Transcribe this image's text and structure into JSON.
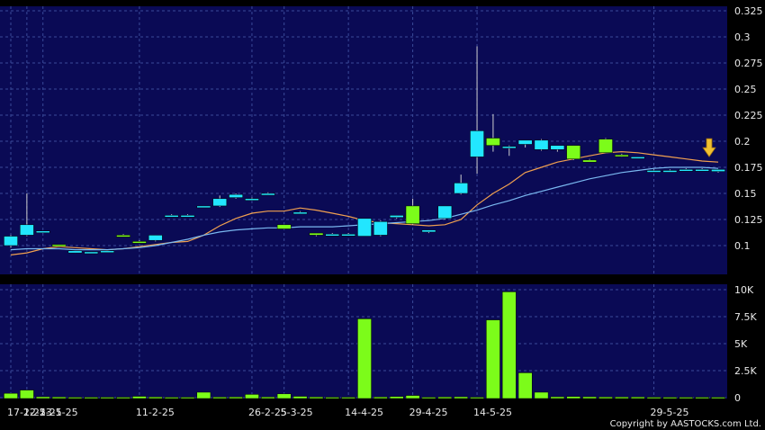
{
  "chart_data": [
    {
      "type": "candlestick",
      "panel": "price",
      "ylim": [
        0.075,
        0.325
      ],
      "yticks": [
        "0.1",
        "0.125",
        "0.15",
        "0.175",
        "0.2",
        "0.225",
        "0.25",
        "0.275",
        "0.3",
        "0.325"
      ],
      "candles": [
        {
          "o": 0.1,
          "h": 0.11,
          "l": 0.098,
          "c": 0.109,
          "color": "cyan"
        },
        {
          "o": 0.11,
          "h": 0.15,
          "l": 0.109,
          "c": 0.12,
          "color": "cyan"
        },
        {
          "o": 0.114,
          "h": 0.114,
          "l": 0.112,
          "c": 0.113,
          "color": "cyan"
        },
        {
          "o": 0.101,
          "h": 0.101,
          "l": 0.099,
          "c": 0.1,
          "color": "green"
        },
        {
          "o": 0.095,
          "h": 0.095,
          "l": 0.093,
          "c": 0.093,
          "color": "cyan"
        },
        {
          "o": 0.094,
          "h": 0.094,
          "l": 0.093,
          "c": 0.093,
          "color": "cyan"
        },
        {
          "o": 0.095,
          "h": 0.095,
          "l": 0.094,
          "c": 0.094,
          "color": "cyan"
        },
        {
          "o": 0.11,
          "h": 0.111,
          "l": 0.109,
          "c": 0.109,
          "color": "green"
        },
        {
          "o": 0.104,
          "h": 0.105,
          "l": 0.103,
          "c": 0.104,
          "color": "green"
        },
        {
          "o": 0.105,
          "h": 0.11,
          "l": 0.104,
          "c": 0.11,
          "color": "cyan"
        },
        {
          "o": 0.129,
          "h": 0.13,
          "l": 0.128,
          "c": 0.129,
          "color": "cyan"
        },
        {
          "o": 0.129,
          "h": 0.13,
          "l": 0.128,
          "c": 0.128,
          "color": "cyan"
        },
        {
          "o": 0.138,
          "h": 0.138,
          "l": 0.137,
          "c": 0.137,
          "color": "cyan"
        },
        {
          "o": 0.138,
          "h": 0.148,
          "l": 0.137,
          "c": 0.145,
          "color": "cyan"
        },
        {
          "o": 0.146,
          "h": 0.15,
          "l": 0.145,
          "c": 0.149,
          "color": "cyan"
        },
        {
          "o": 0.145,
          "h": 0.146,
          "l": 0.144,
          "c": 0.145,
          "color": "cyan"
        },
        {
          "o": 0.15,
          "h": 0.151,
          "l": 0.149,
          "c": 0.15,
          "color": "cyan"
        },
        {
          "o": 0.12,
          "h": 0.12,
          "l": 0.116,
          "c": 0.116,
          "color": "green"
        },
        {
          "o": 0.132,
          "h": 0.133,
          "l": 0.131,
          "c": 0.132,
          "color": "cyan"
        },
        {
          "o": 0.112,
          "h": 0.112,
          "l": 0.109,
          "c": 0.11,
          "color": "green"
        },
        {
          "o": 0.111,
          "h": 0.112,
          "l": 0.11,
          "c": 0.111,
          "color": "cyan"
        },
        {
          "o": 0.111,
          "h": 0.112,
          "l": 0.11,
          "c": 0.111,
          "color": "cyan"
        },
        {
          "o": 0.109,
          "h": 0.125,
          "l": 0.109,
          "c": 0.126,
          "color": "cyan"
        },
        {
          "o": 0.11,
          "h": 0.124,
          "l": 0.109,
          "c": 0.123,
          "color": "cyan"
        },
        {
          "o": 0.127,
          "h": 0.129,
          "l": 0.126,
          "c": 0.129,
          "color": "cyan"
        },
        {
          "o": 0.138,
          "h": 0.145,
          "l": 0.12,
          "c": 0.121,
          "color": "green"
        },
        {
          "o": 0.115,
          "h": 0.115,
          "l": 0.112,
          "c": 0.113,
          "color": "cyan"
        },
        {
          "o": 0.126,
          "h": 0.138,
          "l": 0.125,
          "c": 0.138,
          "color": "cyan"
        },
        {
          "o": 0.15,
          "h": 0.168,
          "l": 0.149,
          "c": 0.16,
          "color": "cyan"
        },
        {
          "o": 0.185,
          "h": 0.291,
          "l": 0.169,
          "c": 0.21,
          "color": "cyan"
        },
        {
          "o": 0.203,
          "h": 0.226,
          "l": 0.19,
          "c": 0.196,
          "color": "green"
        },
        {
          "o": 0.195,
          "h": 0.196,
          "l": 0.186,
          "c": 0.195,
          "color": "cyan"
        },
        {
          "o": 0.197,
          "h": 0.198,
          "l": 0.194,
          "c": 0.201,
          "color": "cyan"
        },
        {
          "o": 0.192,
          "h": 0.202,
          "l": 0.191,
          "c": 0.201,
          "color": "cyan"
        },
        {
          "o": 0.192,
          "h": 0.193,
          "l": 0.19,
          "c": 0.196,
          "color": "cyan"
        },
        {
          "o": 0.196,
          "h": 0.196,
          "l": 0.182,
          "c": 0.183,
          "color": "green"
        },
        {
          "o": 0.182,
          "h": 0.183,
          "l": 0.18,
          "c": 0.18,
          "color": "green"
        },
        {
          "o": 0.202,
          "h": 0.203,
          "l": 0.189,
          "c": 0.189,
          "color": "green"
        },
        {
          "o": 0.187,
          "h": 0.188,
          "l": 0.185,
          "c": 0.186,
          "color": "green"
        },
        {
          "o": 0.185,
          "h": 0.185,
          "l": 0.184,
          "c": 0.184,
          "color": "cyan"
        },
        {
          "o": 0.172,
          "h": 0.173,
          "l": 0.171,
          "c": 0.172,
          "color": "cyan"
        },
        {
          "o": 0.172,
          "h": 0.173,
          "l": 0.171,
          "c": 0.172,
          "color": "cyan"
        },
        {
          "o": 0.173,
          "h": 0.174,
          "l": 0.172,
          "c": 0.173,
          "color": "cyan"
        },
        {
          "o": 0.173,
          "h": 0.174,
          "l": 0.172,
          "c": 0.173,
          "color": "cyan"
        },
        {
          "o": 0.173,
          "h": 0.173,
          "l": 0.17,
          "c": 0.171,
          "color": "cyan"
        }
      ],
      "series": [
        {
          "color": "#f0a050",
          "values": [
            0.091,
            0.093,
            0.097,
            0.099,
            0.098,
            0.097,
            0.096,
            0.097,
            0.099,
            0.101,
            0.103,
            0.104,
            0.11,
            0.119,
            0.126,
            0.131,
            0.133,
            0.133,
            0.136,
            0.134,
            0.131,
            0.128,
            0.124,
            0.122,
            0.121,
            0.12,
            0.119,
            0.12,
            0.125,
            0.139,
            0.15,
            0.159,
            0.17,
            0.175,
            0.18,
            0.183,
            0.186,
            0.189,
            0.19,
            0.189,
            0.187,
            0.185,
            0.183,
            0.181,
            0.18
          ]
        },
        {
          "color": "#7ab8f0",
          "values": [
            0.096,
            0.097,
            0.097,
            0.097,
            0.096,
            0.096,
            0.096,
            0.097,
            0.098,
            0.1,
            0.103,
            0.106,
            0.11,
            0.113,
            0.115,
            0.116,
            0.117,
            0.117,
            0.118,
            0.118,
            0.118,
            0.119,
            0.12,
            0.121,
            0.122,
            0.123,
            0.124,
            0.126,
            0.13,
            0.134,
            0.139,
            0.143,
            0.148,
            0.152,
            0.156,
            0.16,
            0.164,
            0.167,
            0.17,
            0.172,
            0.174,
            0.175,
            0.175,
            0.175,
            0.174
          ]
        }
      ],
      "marker": {
        "type": "arrow-down",
        "index": 44,
        "value": 0.18,
        "color": "#f0c030"
      }
    },
    {
      "type": "bar",
      "panel": "volume",
      "ylim": [
        0,
        10000
      ],
      "yticks": [
        "0",
        "2.5K",
        "5K",
        "7.5K",
        "10K"
      ],
      "values": [
        400,
        700,
        80,
        60,
        40,
        40,
        40,
        40,
        120,
        60,
        40,
        40,
        40,
        50,
        60,
        80,
        60,
        40,
        120,
        60,
        40,
        40,
        40,
        60,
        100,
        80,
        40,
        60,
        80,
        40,
        7200,
        9800,
        2300,
        500,
        80,
        100,
        80,
        60,
        60,
        60,
        40,
        40,
        40,
        40,
        40
      ],
      "colors": [
        "green",
        "green",
        "green",
        "green",
        "green",
        "green",
        "green",
        "green",
        "green",
        "green",
        "green",
        "green",
        "green",
        "green",
        "green",
        "green",
        "green",
        "green",
        "green",
        "green",
        "green",
        "green",
        "green",
        "green",
        "green",
        "green",
        "green",
        "green",
        "green",
        "green",
        "green",
        "green",
        "green",
        "green",
        "green",
        "green",
        "green",
        "green",
        "green",
        "green",
        "green",
        "green",
        "green",
        "green",
        "green"
      ]
    }
  ],
  "volume_bars_extra": [
    {
      "index": 22,
      "value": 7300
    },
    {
      "index": 23,
      "value": 60
    },
    {
      "index": 12,
      "value": 500
    },
    {
      "index": 17,
      "value": 350
    },
    {
      "index": 15,
      "value": 300
    },
    {
      "index": 25,
      "value": 200
    }
  ],
  "xticks": [
    {
      "label": "17-1-25",
      "index": 0
    },
    {
      "label": "22-1-25",
      "index": 1
    },
    {
      "label": "23-1-25",
      "index": 2
    },
    {
      "label": "11-2-25",
      "index": 8
    },
    {
      "label": "26-2-25",
      "index": 15
    },
    {
      "label": "5-3-25",
      "index": 17
    },
    {
      "label": "14-4-25",
      "index": 21
    },
    {
      "label": "29-4-25",
      "index": 25
    },
    {
      "label": "14-5-25",
      "index": 29
    },
    {
      "label": "29-5-25",
      "index": 40
    }
  ],
  "copyright": "Copyright by AASTOCKS.com Ltd.",
  "colors": {
    "background": "#000000",
    "panel": "#0a0a55",
    "grid": "#3a4a99",
    "cyan": "#22e6ff",
    "green": "#7cfc1a",
    "bar_outline": "#000000"
  }
}
